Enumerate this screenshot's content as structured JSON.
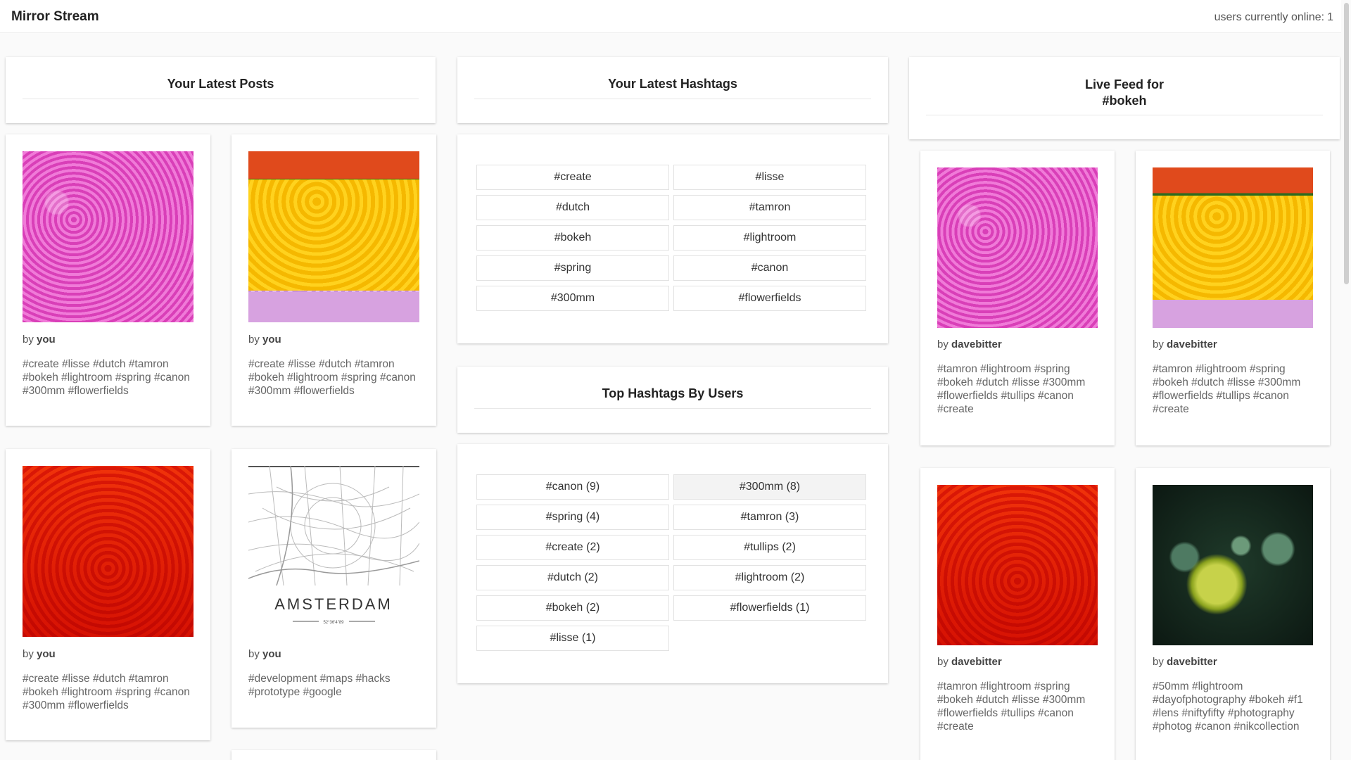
{
  "app": {
    "title": "Mirror Stream",
    "online_label": "users currently online:",
    "online_count": "1"
  },
  "latest_posts": {
    "title": "Your Latest Posts",
    "posts": [
      {
        "image": "pink-tulip-field",
        "by_label": "by",
        "author": "you",
        "tags": "#create #lisse #dutch #tamron #bokeh #lightroom #spring #canon #300mm #flowerfields"
      },
      {
        "image": "yellow-purple-tulip-field",
        "by_label": "by",
        "author": "you",
        "tags": "#create #lisse #dutch #tamron #bokeh #lightroom #spring #canon #300mm #flowerfields"
      },
      {
        "image": "red-tulip-field",
        "by_label": "by",
        "author": "you",
        "tags": "#create #lisse #dutch #tamron #bokeh #lightroom #spring #canon #300mm #flowerfields"
      },
      {
        "image": "amsterdam-map",
        "map_title": "AMSTERDAM",
        "map_coords": "52°36'4\"89",
        "by_label": "by",
        "author": "you",
        "tags": "#development #maps #hacks #prototype #google"
      }
    ]
  },
  "latest_hashtags": {
    "title": "Your Latest Hashtags",
    "items": [
      "#create",
      "#lisse",
      "#dutch",
      "#tamron",
      "#bokeh",
      "#lightroom",
      "#spring",
      "#canon",
      "#300mm",
      "#flowerfields"
    ]
  },
  "top_hashtags": {
    "title": "Top Hashtags By Users",
    "items": [
      "#canon (9)",
      "#300mm (8)",
      "#spring (4)",
      "#tamron (3)",
      "#create (2)",
      "#tullips (2)",
      "#dutch (2)",
      "#lightroom (2)",
      "#bokeh (2)",
      "#flowerfields (1)",
      "#lisse (1)"
    ],
    "highlighted": "#300mm (8)"
  },
  "live_feed": {
    "title_line1": "Live Feed for",
    "title_line2": "#bokeh",
    "posts": [
      {
        "image": "pink-tulip-field",
        "by_label": "by",
        "author": "davebitter",
        "tags": "#tamron #lightroom #spring #bokeh #dutch #lisse #300mm #flowerfields #tullips #canon #create"
      },
      {
        "image": "yellow-purple-tulip-field",
        "by_label": "by",
        "author": "davebitter",
        "tags": "#tamron #lightroom #spring #bokeh #dutch #lisse #300mm #flowerfields #tullips #canon #create"
      },
      {
        "image": "red-tulip-field",
        "by_label": "by",
        "author": "davebitter",
        "tags": "#tamron #lightroom #spring #bokeh #dutch #lisse #300mm #flowerfields #tullips #canon #create"
      },
      {
        "image": "green-fruit-bokeh",
        "by_label": "by",
        "author": "davebitter",
        "tags": "#50mm #lightroom #dayofphotography #bokeh #f1 #lens #niftyfifty #photography #photog #canon #nikcollection"
      }
    ]
  },
  "colors": {
    "background": "#fafafa",
    "card": "#ffffff",
    "text": "#333333",
    "muted": "#666666"
  }
}
